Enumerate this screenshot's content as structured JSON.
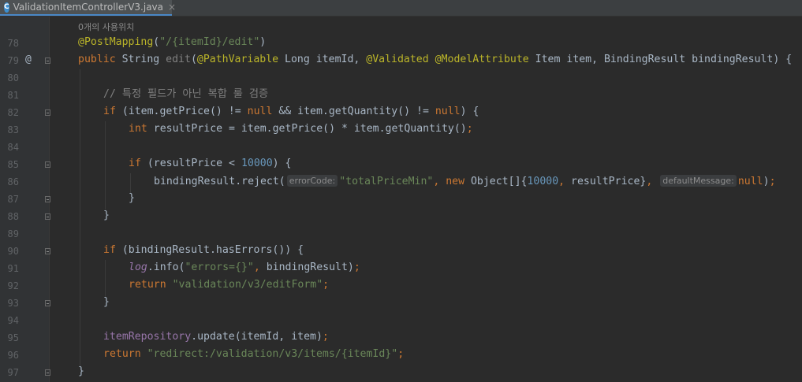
{
  "editor": {
    "tab": {
      "title": "ValidationItemControllerV3.java",
      "icon": "C",
      "close": "×"
    },
    "usage_hint": "0개의 사용위치",
    "gutter_marker": "@",
    "line_numbers": [
      "78",
      "79",
      "80",
      "81",
      "82",
      "83",
      "84",
      "85",
      "86",
      "87",
      "88",
      "89",
      "90",
      "91",
      "92",
      "93",
      "94",
      "95",
      "96",
      "97"
    ],
    "code": {
      "l78": {
        "annotation": "@PostMapping",
        "open": "(",
        "path": "\"/{itemId}/edit\"",
        "close": ")"
      },
      "l79": {
        "public": "public",
        "sig1": " String ",
        "method": "edit",
        "p1": "(",
        "pathvar": "@PathVariable",
        "p2": " Long itemId, ",
        "validated": "@Validated",
        "space": " ",
        "modelattr": "@ModelAttribute",
        "p3": " Item item, BindingResult bindingResult) {"
      },
      "l81": {
        "comment": "// 특정 필드가 아닌 복합 룰 검증"
      },
      "l82": {
        "if": "if",
        "a": " (item.getPrice() != ",
        "null1": "null",
        "b": " && item.getQuantity() != ",
        "null2": "null",
        "c": ") {"
      },
      "l83": {
        "int": "int",
        "a": " resultPrice = item.getPrice() * item.getQuantity()",
        "semi": ";"
      },
      "l85": {
        "if": "if",
        "a": " (resultPrice < ",
        "num": "10000",
        "b": ") {"
      },
      "l86": {
        "a": "bindingResult.reject(",
        "hint1": "errorCode:",
        "str": "\"totalPriceMin\"",
        "comma1": ", ",
        "new": "new",
        "b": " Object[]{",
        "num": "10000",
        "comma2": ", ",
        "c": "resultPrice}",
        "comma3": ", ",
        "hint2": "defaultMessage:",
        "null": "null",
        "d": ")",
        "semi": ";"
      },
      "l87": {
        "brace": "}"
      },
      "l88": {
        "brace": "}"
      },
      "l90": {
        "if": "if",
        "a": " (bindingResult.hasErrors()) {"
      },
      "l91": {
        "log": "log",
        "a": ".info(",
        "str": "\"errors={}\"",
        "comma": ", ",
        "b": "bindingResult)",
        "semi": ";"
      },
      "l92": {
        "return": "return",
        "space": " ",
        "str": "\"validation/v3/editForm\"",
        "semi": ";"
      },
      "l93": {
        "brace": "}"
      },
      "l95": {
        "field": "itemRepository",
        "a": ".update(itemId, item)",
        "semi": ";"
      },
      "l96": {
        "return": "return",
        "space": " ",
        "str": "\"redirect:/validation/v3/items/{itemId}\"",
        "semi": ";"
      },
      "l97": {
        "brace": "}"
      }
    }
  },
  "colors": {
    "background": "#2b2b2b",
    "keyword": "#cc7832",
    "annotation": "#bbb529",
    "string": "#6a8759",
    "number": "#6897bb",
    "comment": "#808080",
    "field": "#9876aa",
    "text": "#a9b7c6"
  }
}
